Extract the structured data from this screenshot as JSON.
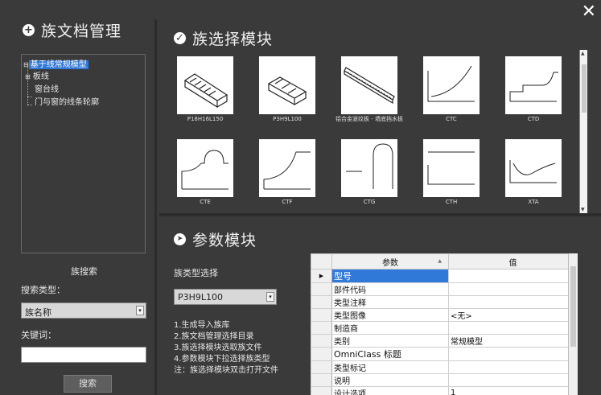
{
  "window": {
    "close_glyph": "✕"
  },
  "left": {
    "title": "族文档管理",
    "title_icon": "plus-circle-icon",
    "tree": [
      {
        "label": "基于线常规模型",
        "expander": "⊟"
      },
      {
        "label": "板线",
        "expander": "⊞"
      },
      {
        "label": "窗台线"
      },
      {
        "label": "门与窗的线条轮廓"
      }
    ],
    "search_title": "族搜索",
    "search_type_label": "搜索类型：",
    "search_type_value": "族名称",
    "keyword_label": "关键词：",
    "keyword_value": "",
    "search_button": "搜索"
  },
  "family_select": {
    "title": "族选择模块",
    "title_icon": "check-circle-icon",
    "thumbs": [
      {
        "caption": "P18H16L150",
        "icon": "bracket-3d-icon"
      },
      {
        "caption": "P3H9L100",
        "icon": "bracket-small-3d-icon"
      },
      {
        "caption": "铝合金波纹板 - 墙底挡水板",
        "icon": "long-bar-3d-icon"
      },
      {
        "caption": "CTC",
        "icon": "profile-arc-icon"
      },
      {
        "caption": "CTD",
        "icon": "profile-step-icon"
      },
      {
        "caption": "CTE",
        "icon": "profile-dome-icon"
      },
      {
        "caption": "CTF",
        "icon": "profile-cove-icon"
      },
      {
        "caption": "CTG",
        "icon": "profile-round-icon"
      },
      {
        "caption": "CTH",
        "icon": "profile-flat-icon"
      },
      {
        "caption": "XTA",
        "icon": "profile-wave-icon"
      }
    ]
  },
  "params": {
    "title": "参数模块",
    "title_icon": "arrow-circle-icon",
    "type_label": "族类型选择",
    "type_value": "P3H9L100",
    "instructions": [
      "1.生成导入族库",
      "2.族文档管理选择目录",
      "3.族选择模块选取族文件",
      "4.参数模块下拉选择族类型",
      "注：族选择模块双击打开文件"
    ],
    "grid": {
      "col_param": "参数",
      "col_value": "值",
      "rows": [
        {
          "param": "型号",
          "value": ""
        },
        {
          "param": "部件代码",
          "value": ""
        },
        {
          "param": "类型注释",
          "value": ""
        },
        {
          "param": "类型图像",
          "value": "<无>"
        },
        {
          "param": "制造商",
          "value": ""
        },
        {
          "param": "类别",
          "value": "常规模型"
        },
        {
          "param": "OmniClass 标题",
          "value": ""
        },
        {
          "param": "类型标记",
          "value": ""
        },
        {
          "param": "说明",
          "value": ""
        },
        {
          "param": "设计选项",
          "value": "1"
        }
      ]
    }
  }
}
